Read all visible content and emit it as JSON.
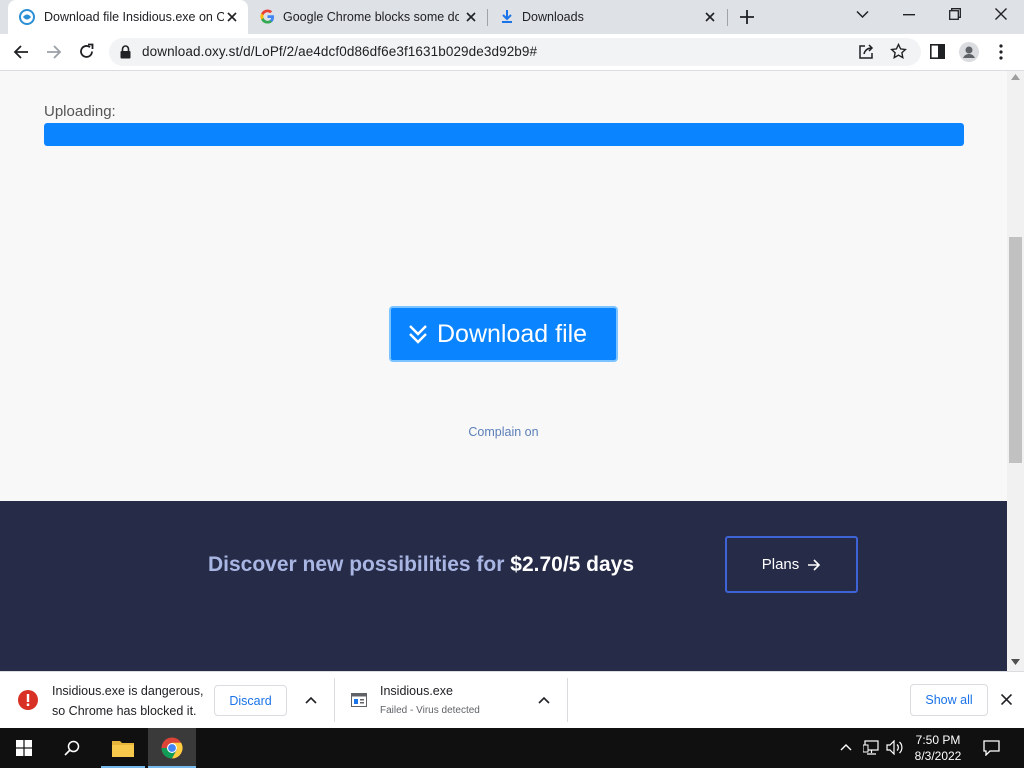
{
  "tabs": [
    {
      "title": "Download file Insidious.exe on Oxy.st",
      "icon": "oxy-logo-icon",
      "active": true
    },
    {
      "title": "Google Chrome blocks some downloads",
      "icon": "google-g-icon",
      "active": false
    },
    {
      "title": "Downloads",
      "icon": "download-arrow-icon",
      "active": false
    }
  ],
  "toolbar": {
    "url": "download.oxy.st/d/LoPf/2/ae4dcf0d86df6e3f1631b029de3d92b9#"
  },
  "page": {
    "upload_label": "Uploading:",
    "upload_progress": 1.0,
    "download_button": "Download file",
    "complain_link": "Complain on",
    "promo_text": "Discover new possibilities for",
    "promo_price": "$2.70/5 days",
    "plans_button": "Plans"
  },
  "shelf": {
    "warning_line1": "Insidious.exe is dangerous,",
    "warning_line2": "so Chrome has blocked it.",
    "discard": "Discard",
    "file_name": "Insidious.exe",
    "file_status": "Failed - Virus detected",
    "show_all": "Show all"
  },
  "taskbar": {
    "time": "7:50 PM",
    "date": "8/3/2022"
  },
  "colors": {
    "accent_blue": "#0a84ff",
    "promo_bg": "#262c47",
    "danger_red": "#d93025",
    "link_blue": "#1a73e8"
  }
}
